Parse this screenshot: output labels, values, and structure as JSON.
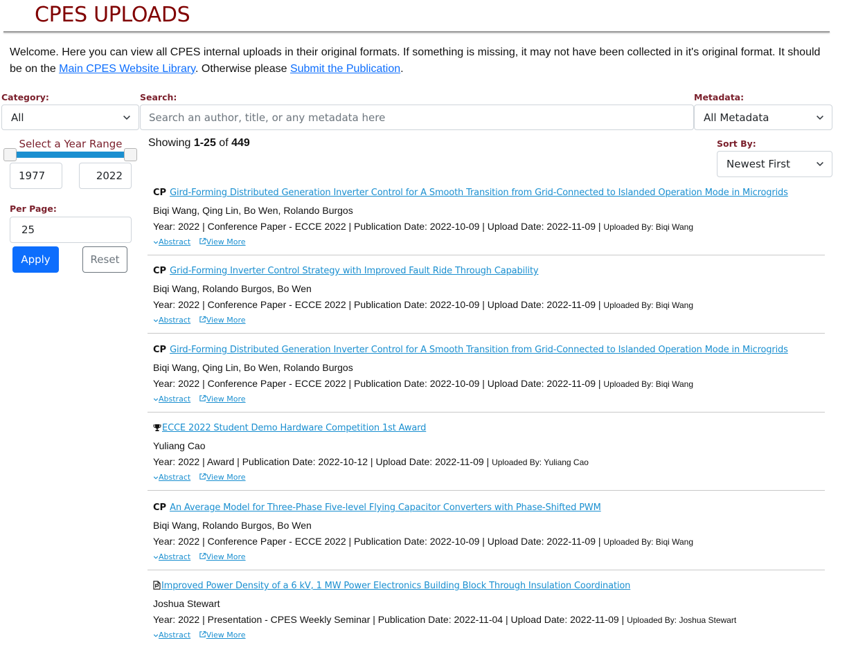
{
  "header": {
    "title": "CPES UPLOADS"
  },
  "welcome": {
    "text_before": "Welcome. Here you can view all CPES internal uploads in their original formats. If something is missing, it may not have been collected in it's original format. It should be on the ",
    "link1": "Main CPES Website Library",
    "text_middle": ". Otherwise please ",
    "link2": "Submit the Publication",
    "text_end": "."
  },
  "filters": {
    "category_label": "Category:",
    "category_value": "All",
    "search_label": "Search:",
    "search_placeholder": "Search an author, title, or any metadata here",
    "search_value": "",
    "metadata_label": "Metadata:",
    "metadata_value": "All Metadata",
    "year_range_label": "Select a Year Range",
    "year_min": "1977",
    "year_max": "2022",
    "per_page_label": "Per Page:",
    "per_page_value": "25",
    "apply_label": "Apply",
    "reset_label": "Reset",
    "sort_label": "Sort By:",
    "sort_value": "Newest First"
  },
  "showing": {
    "prefix": "Showing ",
    "range": "1-25",
    "of": " of ",
    "total": "449"
  },
  "results": [
    {
      "type": "CP",
      "icon": "",
      "title": "Gird-Forming Distributed Generation Inverter Control for A Smooth Transition from Grid-Connected to Islanded Operation Mode in Microgrids",
      "authors": "Biqi Wang, Qing Lin, Bo Wen, Rolando Burgos",
      "meta": "Year: 2022 | Conference Paper - ECCE 2022 | Publication Date: 2022-10-09 | Upload Date: 2022-11-09 |",
      "uploaded_by": "Uploaded By: Biqi Wang",
      "abstract_label": "Abstract",
      "view_more_label": "View More"
    },
    {
      "type": "CP",
      "icon": "",
      "title": "Grid-Forming Inverter Control Strategy with Improved Fault Ride Through Capability",
      "authors": "Biqi Wang, Rolando Burgos, Bo Wen",
      "meta": "Year: 2022 | Conference Paper - ECCE 2022 | Publication Date: 2022-10-09 | Upload Date: 2022-11-09 |",
      "uploaded_by": "Uploaded By: Biqi Wang",
      "abstract_label": "Abstract",
      "view_more_label": "View More"
    },
    {
      "type": "CP",
      "icon": "",
      "title": "Gird-Forming Distributed Generation Inverter Control for A Smooth Transition from Grid-Connected to Islanded Operation Mode in Microgrids",
      "authors": "Biqi Wang, Qing Lin, Bo Wen, Rolando Burgos",
      "meta": "Year: 2022 | Conference Paper - ECCE 2022 | Publication Date: 2022-10-09 | Upload Date: 2022-11-09 |",
      "uploaded_by": "Uploaded By: Biqi Wang",
      "abstract_label": "Abstract",
      "view_more_label": "View More"
    },
    {
      "type": "",
      "icon": "trophy-icon",
      "title": "ECCE 2022 Student Demo Hardware Competition 1st Award",
      "authors": "Yuliang Cao",
      "meta": "Year: 2022 | Award | Publication Date: 2022-10-12 | Upload Date: 2022-11-09 |",
      "uploaded_by": "Uploaded By: Yuliang Cao",
      "abstract_label": "Abstract",
      "view_more_label": "View More"
    },
    {
      "type": "CP",
      "icon": "",
      "title": "An Average Model for Three-Phase Five-level Flying Capacitor Converters with Phase-Shifted PWM",
      "authors": "Biqi Wang, Rolando Burgos, Bo Wen",
      "meta": "Year: 2022 | Conference Paper - ECCE 2022 | Publication Date: 2022-10-09 | Upload Date: 2022-11-09 |",
      "uploaded_by": "Uploaded By: Biqi Wang",
      "abstract_label": "Abstract",
      "view_more_label": "View More"
    },
    {
      "type": "",
      "icon": "presentation-file-icon",
      "title": "Improved Power Density of a 6 kV, 1 MW Power Electronics Building Block Through Insulation Coordination",
      "authors": "Joshua Stewart",
      "meta": "Year: 2022 | Presentation - CPES Weekly Seminar | Publication Date: 2022-11-04 | Upload Date: 2022-11-09 |",
      "uploaded_by": "Uploaded By: Joshua Stewart",
      "abstract_label": "Abstract",
      "view_more_label": "View More"
    }
  ]
}
